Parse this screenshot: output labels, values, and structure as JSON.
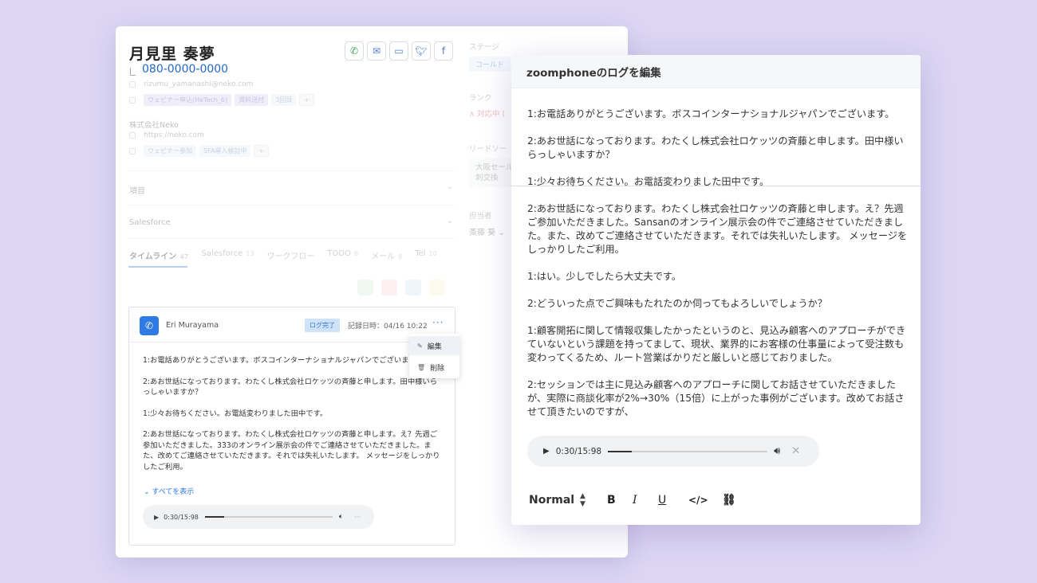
{
  "crm": {
    "contact_name": "月見里 奏夢",
    "phone": "080-0000-0000",
    "email": "rizumu_yamanashi@neko.com",
    "contact_tags": [
      "ウェビナー申込(HeTech_6)",
      "資料送付",
      "3回目"
    ],
    "company": "株式会社Neko",
    "company_url": "https://neko.com",
    "company_tags": [
      "ウェビナー参加",
      "SFA導入検討中"
    ],
    "sections": [
      "項目",
      "Salesforce"
    ],
    "tabs": [
      {
        "label": "タイムライン",
        "count": "47"
      },
      {
        "label": "Salesforce",
        "count": "13"
      },
      {
        "label": "ワークフロー",
        "count": ""
      },
      {
        "label": "TODO",
        "count": "6"
      },
      {
        "label": "メール",
        "count": "8"
      },
      {
        "label": "Tel",
        "count": "10"
      }
    ],
    "right": {
      "stage_label": "ステージ",
      "stage_value": "コールド",
      "rank_label": "ランク",
      "rank_value": "∧ 対応中 (",
      "lead_label": "リードソー",
      "lead_value_1": "大阪セール",
      "lead_value_2": "刺交換",
      "owner_label": "担当者",
      "owner_value": "斎藤 葵 ⌄"
    }
  },
  "log_card": {
    "author": "Eri Murayama",
    "status_badge": "ログ完了",
    "timestamp": "記録日時：04/16 10:22",
    "more": "···",
    "lines": [
      "1:お電話ありがとうございます。ボスコインターナショナルジャパンでございます。",
      "2:あお世話になっております。わたくし株式会社ロケッツの斉藤と申します。田中様いらっしゃいますか？",
      "1:少々お待ちください。お電話変わりました田中です。",
      "2:あお世話になっております。わたくし株式会社ロケッツの斉藤と申します。え？先週ご参加いただきました。333のオンライン展示会の件でご連絡させていただきました。また、改めてご連絡させていただきます。それでは失礼いたします。 メッセージをしっかりしたご利用。"
    ],
    "show_all": "すべてを表示",
    "player_time": "0:30/15:98",
    "menu": {
      "edit": "編集",
      "delete": "削除"
    }
  },
  "dialog": {
    "title": "zoomphoneのログを編集",
    "paragraphs": [
      "1:お電話ありがとうございます。ボスコインターナショナルジャパンでございます。",
      "2:あお世話になっております。わたくし株式会社ロケッツの斉藤と申します。田中様いらっしゃいますか？",
      "1:少々お待ちください。お電話変わりました田中です。",
      "2:あお世話になっております。わたくし株式会社ロケッツの斉藤と申します。え？先週ご参加いただきました。Sansanのオンライン展示会の件でご連絡させていただきました。また、改めてご連絡させていただきます。それでは失礼いたします。 メッセージをしっかりしたご利用。",
      "1:はい。少しでしたら大丈夫です。",
      "2:どういった点でご興味もたれたのか伺ってもよろしいでしょうか？",
      "1:顧客開拓に関して情報収集したかったというのと、見込み顧客へのアプローチができていないという課題を持ってまして、現状、業界的にお客様の仕事量によって受注数も変わってくるため、ルート営業ばかりだと厳しいと感じておりました。",
      "2:セッションでは主に見込み顧客へのアプローチに関してお話させていただきましたが、実際に商談化率が2%→30%（15倍）に上がった事例がございます。改めてお話させて頂きたいのですが、"
    ],
    "player_time": "0:30/15:98",
    "format_select": "Normal",
    "toolbar": {
      "bold": "B",
      "italic": "I",
      "underline": "U",
      "code": "</>",
      "link": "⛓"
    }
  },
  "colors": {
    "background": "#dcd6f3",
    "accent": "#2f7ae5",
    "phone_blue": "#2468c8"
  }
}
